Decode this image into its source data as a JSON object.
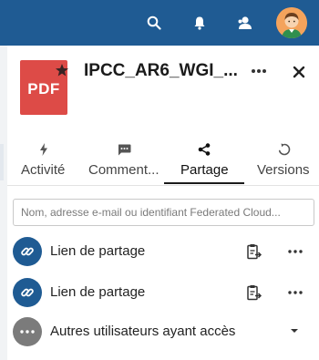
{
  "header": {
    "icons": [
      "search-icon",
      "bell-icon",
      "contacts-icon"
    ],
    "avatar": "user-avatar",
    "bar_color": "#1f5b93"
  },
  "file": {
    "type_badge": "PDF",
    "badge_color": "#dd4b47",
    "name": "IPCC_AR6_WGI_...",
    "favorite_icon": "star-icon"
  },
  "tabs": [
    {
      "label": "Activité",
      "icon": "lightning-icon",
      "active": false
    },
    {
      "label": "Comment...",
      "icon": "comment-icon",
      "active": false
    },
    {
      "label": "Partage",
      "icon": "share-icon",
      "active": true
    },
    {
      "label": "Versions",
      "icon": "history-icon",
      "active": false
    }
  ],
  "share": {
    "search_placeholder": "Nom, adresse e-mail ou identifiant Federated Cloud...",
    "links": [
      {
        "label": "Lien de partage",
        "icon": "link-icon"
      },
      {
        "label": "Lien de partage",
        "icon": "link-icon"
      }
    ],
    "others": {
      "label": "Autres utilisateurs ayant accès",
      "icon": "more-icon"
    }
  },
  "colors": {
    "accent": "#1f5b93",
    "pdf": "#dd4b47",
    "others": "#7b7b7b"
  }
}
